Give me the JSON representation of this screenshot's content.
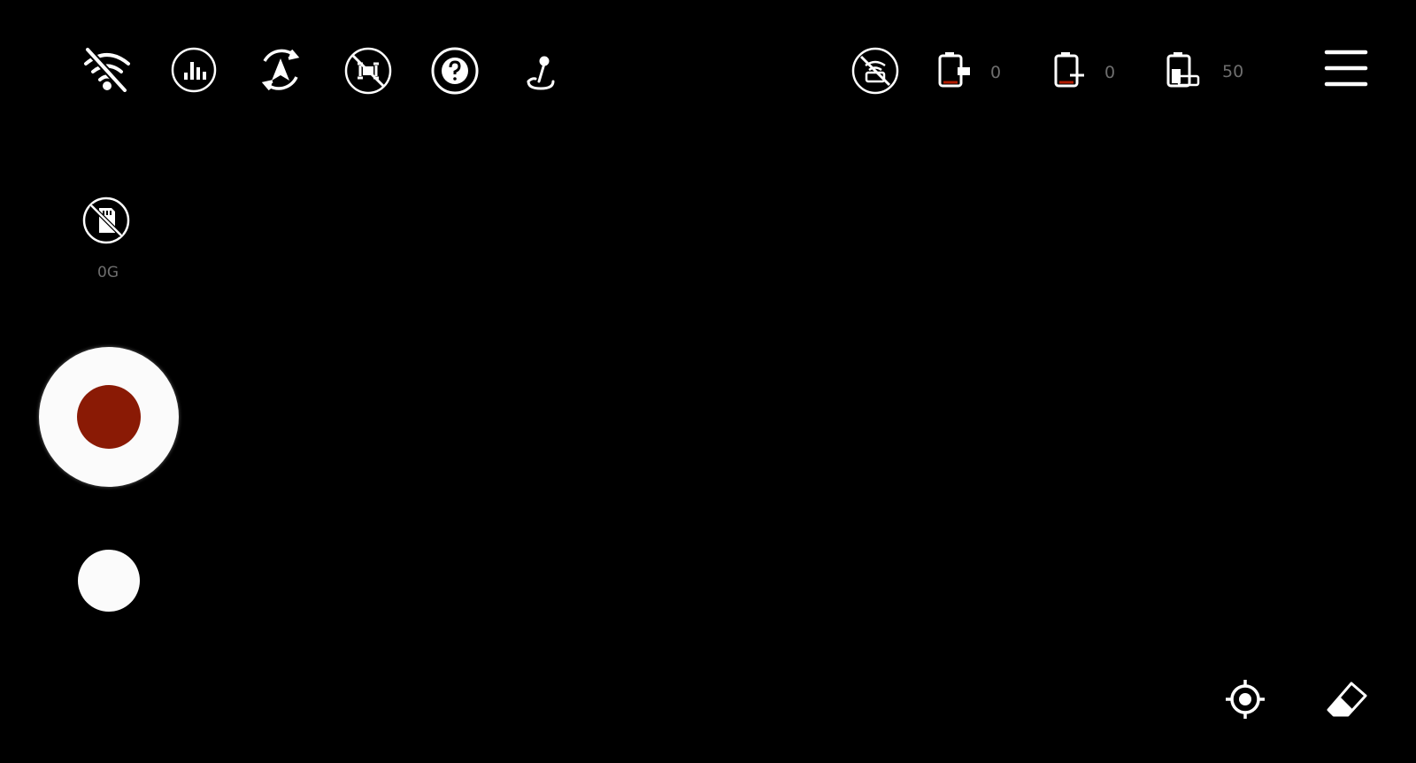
{
  "top_bar": {
    "left_icons": [
      "wifi-off-icon",
      "signal-bars-icon",
      "auto-pilot-icon",
      "drone-disconnected-icon",
      "help-icon",
      "joystick-icon"
    ],
    "status": {
      "remote_battery": "0",
      "drone_battery": "0",
      "phone_battery": "50"
    },
    "right_icons": [
      "link-off-icon",
      "remote-battery-icon",
      "drone-battery-icon",
      "phone-battery-icon",
      "menu-icon"
    ]
  },
  "storage": {
    "icon": "sd-card-off-icon",
    "label": "0G"
  },
  "controls": {
    "record_button": "record-button",
    "photo_button": "photo-button",
    "record_color": "#8a1a05"
  },
  "bottom_right": {
    "icons": [
      "locate-icon",
      "eraser-icon"
    ]
  }
}
